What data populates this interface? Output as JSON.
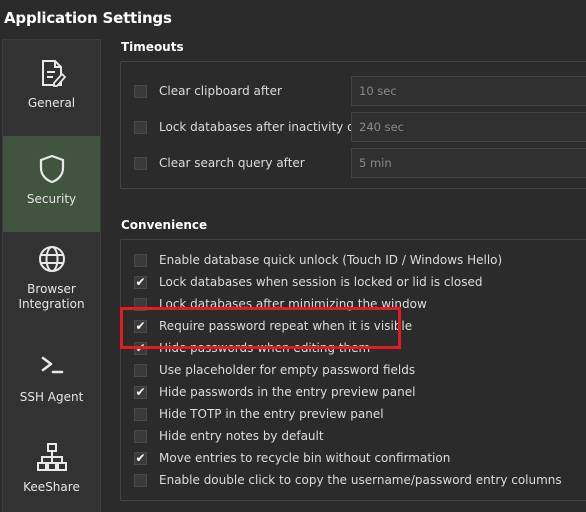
{
  "window": {
    "title": "Application Settings"
  },
  "sidebar": {
    "items": [
      {
        "label": "General",
        "icon": "general-icon",
        "active": false
      },
      {
        "label": "Security",
        "icon": "shield-icon",
        "active": true
      },
      {
        "label": "Browser Integration",
        "icon": "globe-icon",
        "active": false
      },
      {
        "label": "SSH Agent",
        "icon": "terminal-icon",
        "active": false
      },
      {
        "label": "KeeShare",
        "icon": "network-icon",
        "active": false
      }
    ]
  },
  "timeouts": {
    "title": "Timeouts",
    "rows": [
      {
        "label": "Clear clipboard after",
        "checked": false,
        "value": "10 sec"
      },
      {
        "label": "Lock databases after inactivity of",
        "checked": false,
        "value": "240 sec"
      },
      {
        "label": "Clear search query after",
        "checked": false,
        "value": "5 min"
      }
    ]
  },
  "convenience": {
    "title": "Convenience",
    "rows": [
      {
        "label": "Enable database quick unlock (Touch ID / Windows Hello)",
        "checked": false
      },
      {
        "label": "Lock databases when session is locked or lid is closed",
        "checked": true
      },
      {
        "label": "Lock databases after minimizing the window",
        "checked": false
      },
      {
        "label": "Require password repeat when it is visible",
        "checked": true
      },
      {
        "label": "Hide passwords when editing them",
        "checked": true
      },
      {
        "label": "Use placeholder for empty password fields",
        "checked": false
      },
      {
        "label": "Hide passwords in the entry preview panel",
        "checked": true
      },
      {
        "label": "Hide TOTP in the entry preview panel",
        "checked": false
      },
      {
        "label": "Hide entry notes by default",
        "checked": false
      },
      {
        "label": "Move entries to recycle bin without confirmation",
        "checked": true
      },
      {
        "label": "Enable double click to copy the username/password entry columns",
        "checked": false
      }
    ]
  },
  "colors": {
    "active_sidebar": "#41543f",
    "highlight_border": "#e31c23",
    "background": "#2b2b2b"
  }
}
